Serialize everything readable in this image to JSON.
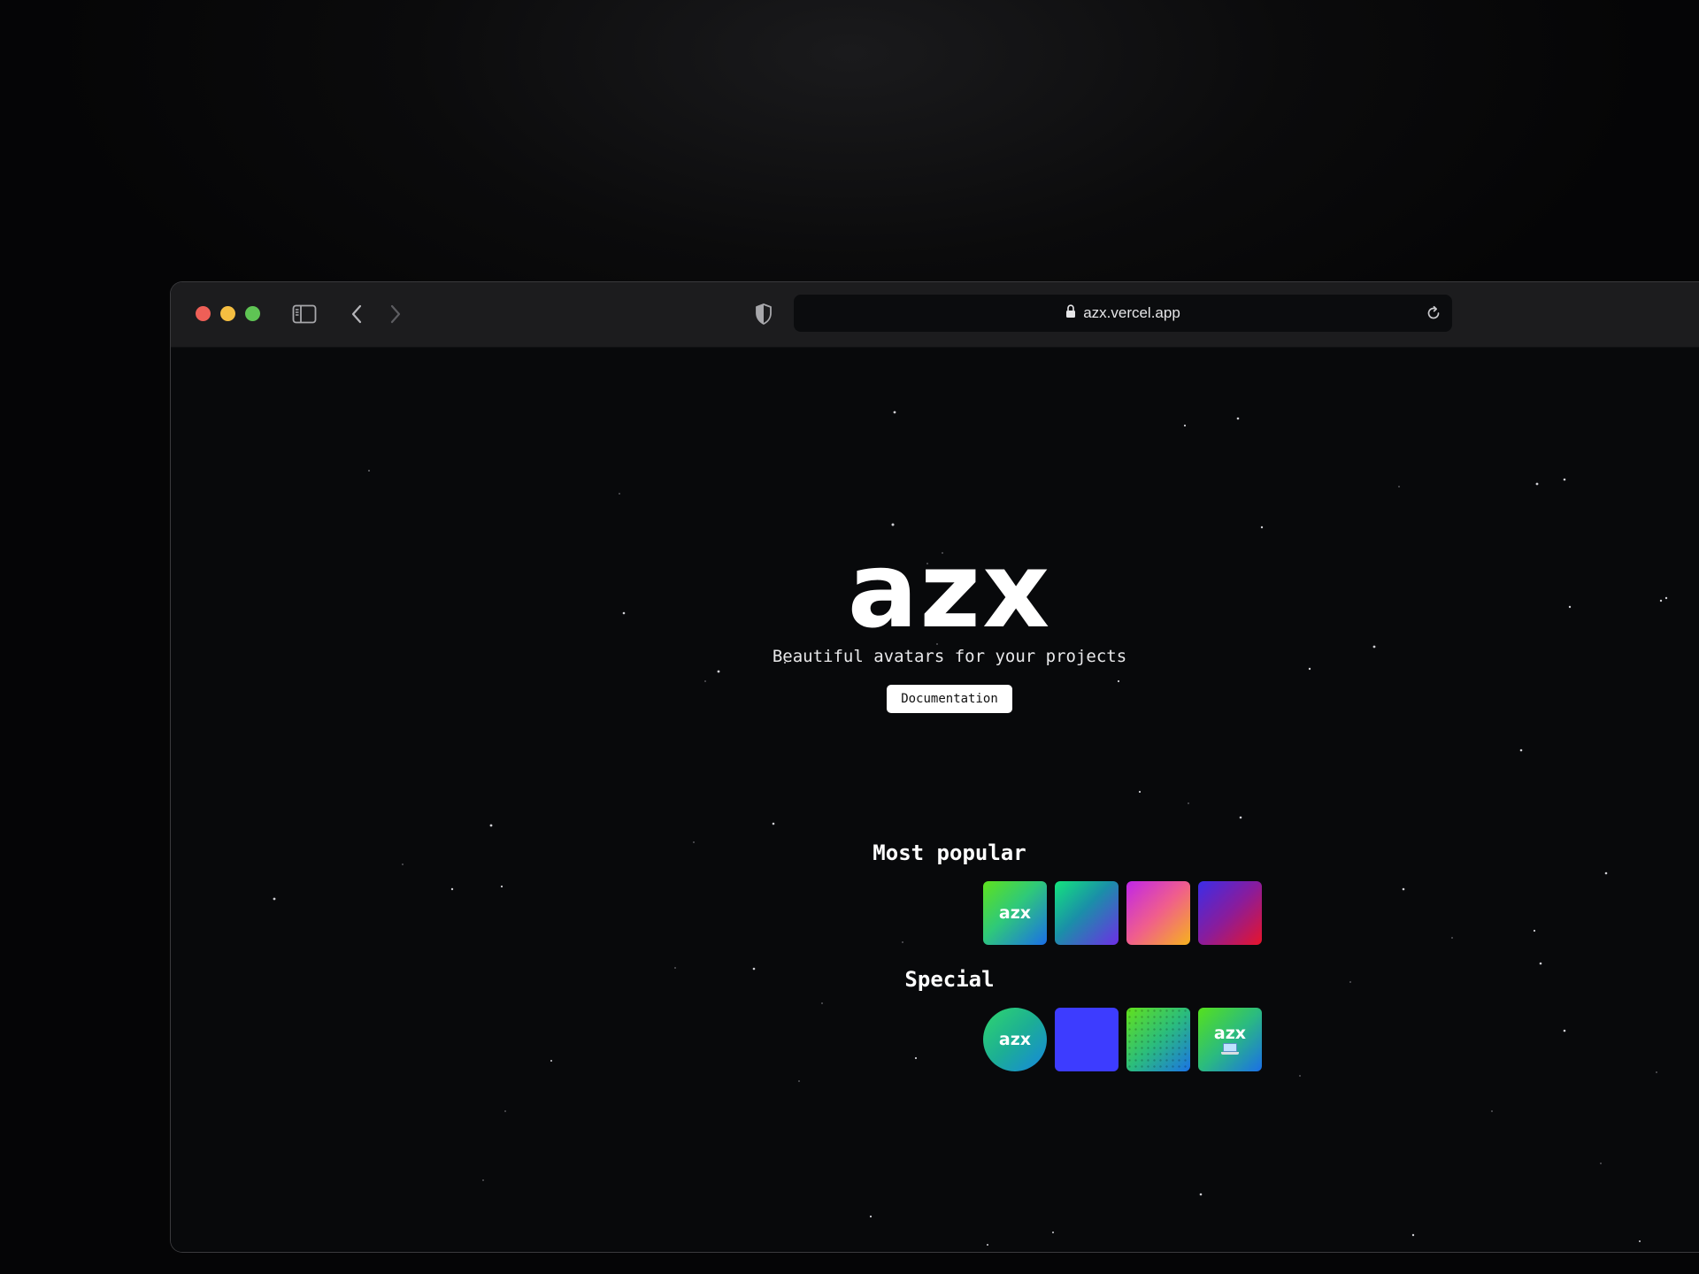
{
  "browser": {
    "url": "azx.vercel.app"
  },
  "hero": {
    "logo": "azx",
    "tagline": "Beautiful avatars for your projects",
    "cta_label": "Documentation"
  },
  "sections": {
    "popular": {
      "title": "Most popular",
      "avatars": [
        {
          "label": "azx",
          "colors": [
            "#5ee21d",
            "#1b6ee8"
          ]
        },
        {
          "label": "",
          "colors": [
            "#14e37d",
            "#6d2ee6"
          ]
        },
        {
          "label": "",
          "colors": [
            "#c026e8",
            "#f6b21d"
          ]
        },
        {
          "label": "",
          "colors": [
            "#3b2de8",
            "#e8142a"
          ]
        }
      ]
    },
    "special": {
      "title": "Special",
      "avatars": [
        {
          "label": "azx",
          "colors": [
            "#2fd66c",
            "#1686e0"
          ]
        },
        {
          "label": "",
          "colors": [
            "#3d3cff"
          ]
        },
        {
          "label": "",
          "colors": [
            "#62e21b",
            "#1b73e6"
          ]
        },
        {
          "label": "azx",
          "colors": [
            "#55e11c",
            "#1b6fe8"
          ]
        }
      ]
    }
  },
  "colors": {
    "page_background": "#08090b",
    "titlebar": "#1c1c1e",
    "traffic_red": "#ee5f57",
    "traffic_yellow": "#f5be41",
    "traffic_green": "#5fc454"
  }
}
